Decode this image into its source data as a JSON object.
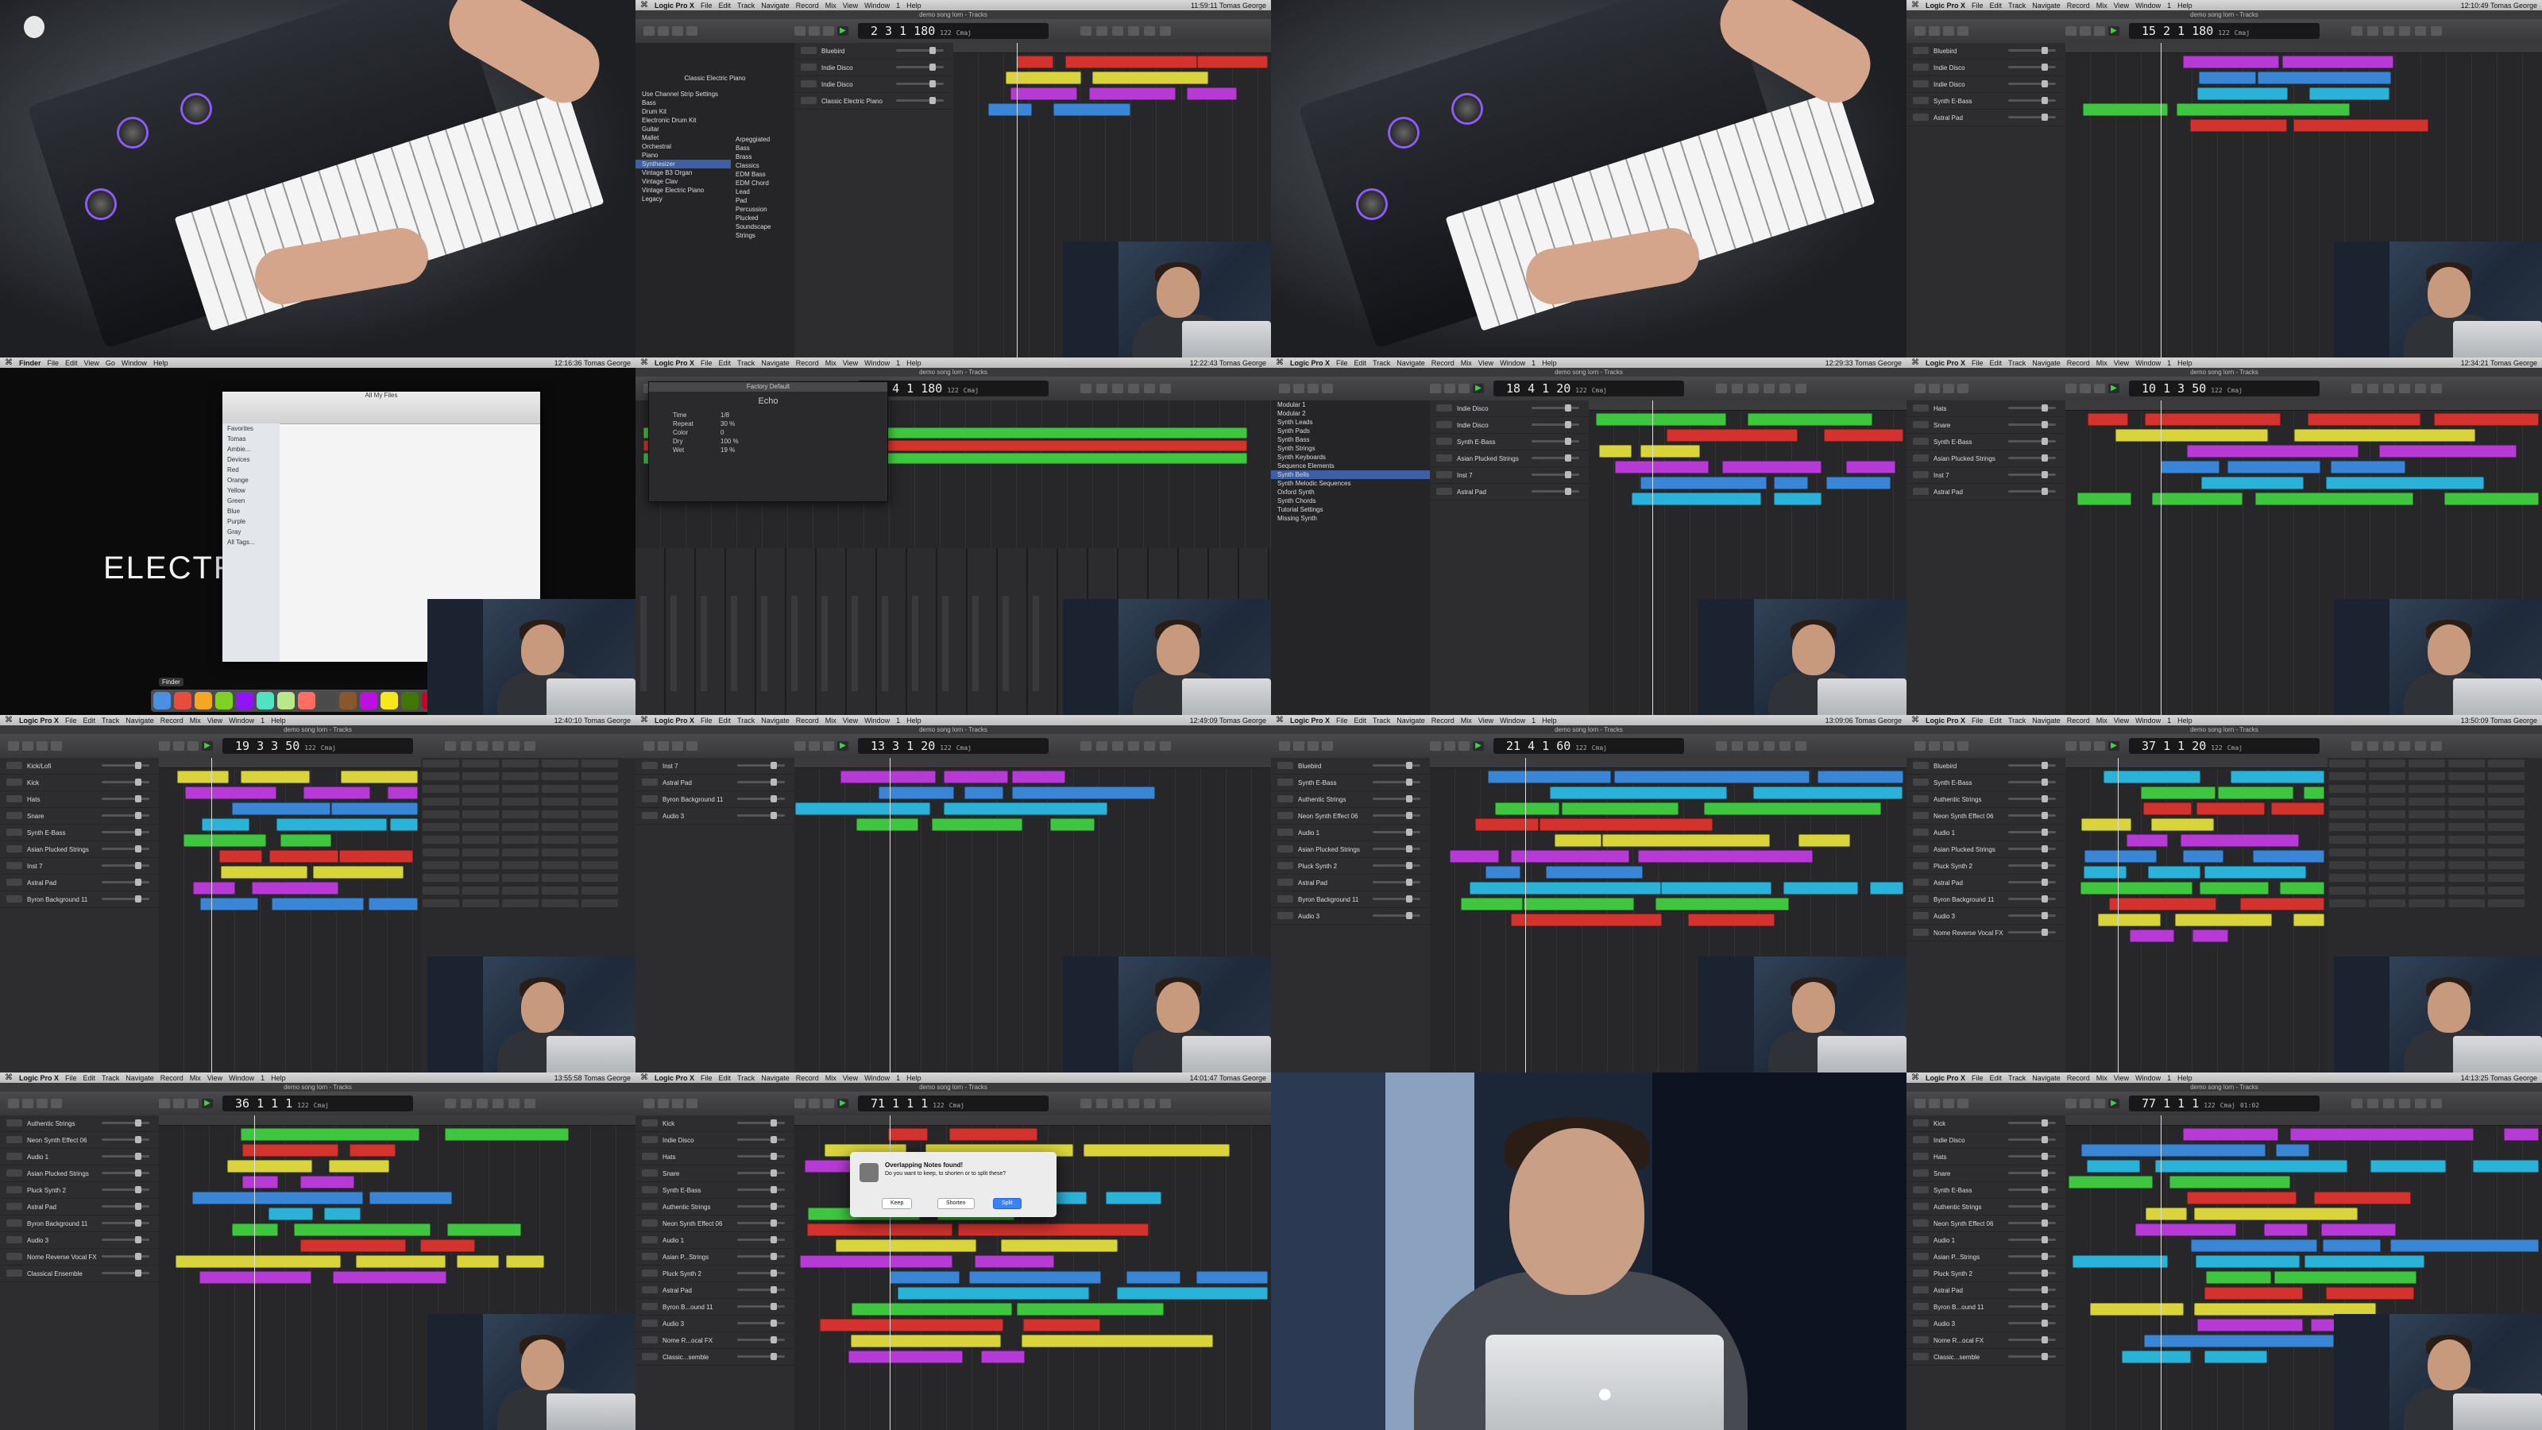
{
  "menubar": {
    "logic_items": [
      "Logic Pro X",
      "File",
      "Edit",
      "Track",
      "Navigate",
      "Record",
      "Mix",
      "View",
      "Window",
      "1",
      "Help"
    ],
    "finder_items": [
      "Finder",
      "File",
      "Edit",
      "View",
      "Go",
      "Window",
      "Help"
    ],
    "user": "Tomas George"
  },
  "window_title": "demo song lorn - Tracks",
  "tiles": [
    {
      "kind": "keyboard"
    },
    {
      "kind": "logic",
      "lcd": "2  3  1  180",
      "tempo": "122",
      "key": "Cmaj",
      "clock": "11:59:11",
      "tracks": [
        "Bluebird",
        "Indie Disco",
        "Indie Disco",
        "Classic Electric Piano"
      ],
      "library_title": "Classic Electric Piano",
      "library": [
        "Use Channel Strip Settings",
        "Bass",
        "Drum Kit",
        "Electronic Drum Kit",
        "Guitar",
        "Mallet",
        "Orchestral",
        "Piano",
        "Synthesizer",
        "Vintage B3 Organ",
        "Vintage Clav",
        "Vintage Electric Piano",
        "Legacy"
      ],
      "library2": [
        "Arpeggiated",
        "Bass",
        "Brass",
        "Classics",
        "EDM Bass",
        "EDM Chord",
        "Lead",
        "Pad",
        "Percussion",
        "Plucked",
        "Soundscape",
        "Strings"
      ]
    },
    {
      "kind": "keyboard"
    },
    {
      "kind": "logic",
      "lcd": "15  2  1  180",
      "tempo": "122",
      "key": "Cmaj",
      "clock": "12:10:49",
      "tracks": [
        "Bluebird",
        "Indie Disco",
        "Indie Disco",
        "Synth E-Bass",
        "Astral Pad"
      ]
    },
    {
      "kind": "finder",
      "clock": "12:16:36",
      "title": "All My Files",
      "sidebar": [
        "Favorites",
        "Tomas",
        "Ambie...",
        "Devices",
        "Red",
        "Orange",
        "Yellow",
        "Green",
        "Blue",
        "Purple",
        "Gray",
        "All Tags..."
      ],
      "bigtext": "ELECTR",
      "dock_label": "Finder"
    },
    {
      "kind": "plugin",
      "lcd": "22  4  1  180",
      "tempo": "122",
      "key": "Cmaj",
      "clock": "12:22:43",
      "plugin_title": "Factory Default",
      "plugin_name": "Echo",
      "plugin_params": [
        "Time",
        "Repeat",
        "Color",
        "Dry",
        "Wet"
      ],
      "plugin_values": [
        "1/8",
        "30 %",
        "0",
        "100 %",
        "19 %"
      ]
    },
    {
      "kind": "logic",
      "lcd": "18  4  1  20",
      "tempo": "122",
      "key": "Cmaj",
      "clock": "12:29:33",
      "tracks": [
        "Indie Disco",
        "Indie Disco",
        "Synth E-Bass",
        "Asian Plucked Strings",
        "Inst 7",
        "Astral Pad"
      ],
      "library": [
        "Modular 1",
        "Modular 2",
        "Synth Leads",
        "Synth Pads",
        "Synth Bass",
        "Synth Strings",
        "Synth Keyboards",
        "Sequence Elements",
        "Synth Bells",
        "Synth Melodic Sequences",
        "Oxford Synth",
        "Synth Chords",
        "Tutorial Settings",
        "Missing Synth"
      ]
    },
    {
      "kind": "logic",
      "lcd": "10  1  3  50",
      "tempo": "122",
      "key": "Cmaj",
      "clock": "12:34:21",
      "tracks": [
        "Hats",
        "Snare",
        "Synth E-Bass",
        "Asian Plucked Strings",
        "Inst 7",
        "Astral Pad"
      ]
    },
    {
      "kind": "logic",
      "lcd": "19  3  3  50",
      "tempo": "122",
      "key": "Cmaj",
      "clock": "12:40:10",
      "tracks": [
        "Kick/Lofi",
        "Kick",
        "Hats",
        "Snare",
        "Synth E-Bass",
        "Asian Plucked Strings",
        "Inst 7",
        "Astral Pad",
        "Byron Background 11"
      ],
      "loops": true
    },
    {
      "kind": "logic",
      "lcd": "13  3  1  20",
      "tempo": "122",
      "key": "Cmaj",
      "clock": "12:49:09",
      "tracks": [
        "Inst 7",
        "Astral Pad",
        "Byron Background 11",
        "Audio 3"
      ]
    },
    {
      "kind": "logic",
      "lcd": "21  4  1  60",
      "tempo": "122",
      "key": "Cmaj",
      "clock": "13:09:06",
      "tracks": [
        "Bluebird",
        "Synth E-Bass",
        "Authentic Strings",
        "Neon Synth Effect 06",
        "Audio 1",
        "Asian Plucked Strings",
        "Pluck Synth 2",
        "Astral Pad",
        "Byron Background 11",
        "Audio 3"
      ]
    },
    {
      "kind": "logic",
      "lcd": "37  1  1  20",
      "tempo": "122",
      "key": "Cmaj",
      "clock": "13:50:09",
      "tracks": [
        "Bluebird",
        "Synth E-Bass",
        "Authentic Strings",
        "Neon Synth Effect 06",
        "Audio 1",
        "Asian Plucked Strings",
        "Pluck Synth 2",
        "Astral Pad",
        "Byron Background 11",
        "Audio 3",
        "Nome Reverse Vocal FX"
      ],
      "loops": true
    },
    {
      "kind": "logic",
      "lcd": "36  1  1  1",
      "tempo": "122",
      "key": "Cmaj",
      "clock": "13:55:58",
      "tracks": [
        "Authentic Strings",
        "Neon Synth Effect 06",
        "Audio 1",
        "Asian Plucked Strings",
        "Pluck Synth 2",
        "Astral Pad",
        "Byron Background 11",
        "Audio 3",
        "Nome Reverse Vocal FX",
        "Classical Ensemble"
      ]
    },
    {
      "kind": "dialog",
      "lcd": "71  1  1  1",
      "tempo": "122",
      "key": "Cmaj",
      "clock": "14:01:47",
      "dialog_title": "Overlapping Notes found!",
      "dialog_msg": "Do you want to keep, to shorten or to split these?",
      "dialog_buttons": [
        "Keep",
        "Shorten",
        "Split"
      ],
      "tracks": [
        "Kick",
        "Indie Disco",
        "Hats",
        "Snare",
        "Synth E-Bass",
        "Authentic Strings",
        "Neon Synth Effect 06",
        "Audio 1",
        "Asian P...Strings",
        "Pluck Synth 2",
        "Astral Pad",
        "Byron B...ound 11",
        "Audio 3",
        "Nome R...ocal FX",
        "Classic...semble"
      ]
    },
    {
      "kind": "presenter"
    },
    {
      "kind": "logic",
      "lcd": "77  1  1  1",
      "tempo": "122",
      "key": "Cmaj",
      "clock": "14:13:25",
      "time_display": "01:02",
      "tracks": [
        "Kick",
        "Indie Disco",
        "Hats",
        "Snare",
        "Synth E-Bass",
        "Authentic Strings",
        "Neon Synth Effect 06",
        "Audio 1",
        "Asian P...Strings",
        "Pluck Synth 2",
        "Astral Pad",
        "Byron B...ound 11",
        "Audio 3",
        "Nome R...ocal FX",
        "Classic...semble"
      ]
    }
  ],
  "colors": {
    "green": "#3ec73e",
    "red": "#d4322c",
    "yellow": "#d8d43a",
    "purple": "#b83ad6",
    "blue": "#3a86d6",
    "cyan": "#2ab3d9",
    "lcd_bg": "#181818",
    "apple_logo": ""
  }
}
